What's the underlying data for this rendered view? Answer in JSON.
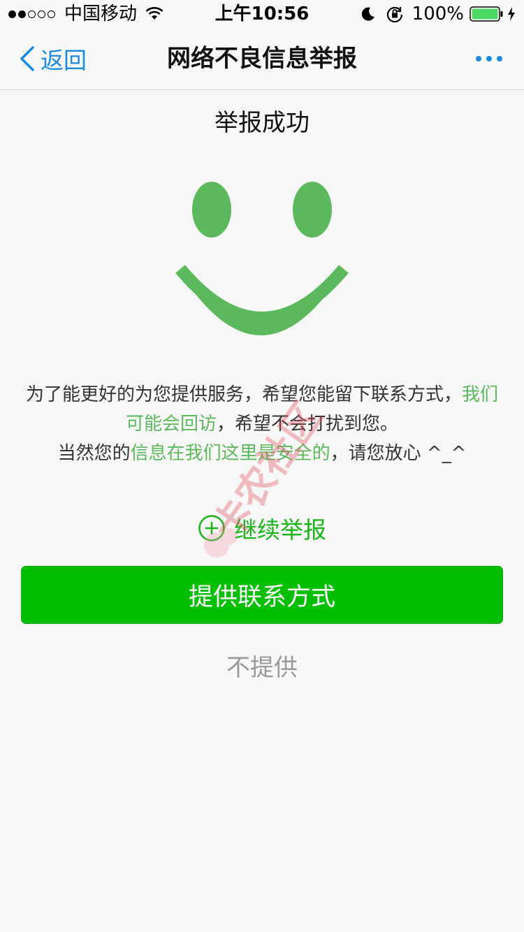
{
  "status_bar": {
    "carrier": "中国移动",
    "time": "上午10:56",
    "battery": "100%"
  },
  "nav": {
    "back_label": "返回",
    "title": "网络不良信息举报"
  },
  "content": {
    "success_title": "举报成功",
    "message": {
      "line1_prefix": "为了能更好的为您提供服务，希望您能留下联系方式，",
      "line1_green": "我们",
      "line2_green": "可能会回访",
      "line2_suffix": "，希望不会打扰到您。",
      "line3_prefix": "当然您的",
      "line3_green": "信息在我们这里是安全的",
      "line3_suffix": "，请您放心 ^_^"
    },
    "continue_label": "继续举报",
    "provide_button": "提供联系方式",
    "decline_label": "不提供"
  },
  "watermark_text": "卡农社区",
  "colors": {
    "accent_green": "#5cb85c",
    "button_green": "#04be02",
    "link_blue": "#1a8be0"
  },
  "icons": [
    "wifi-icon",
    "moon-icon",
    "rotation-lock-icon",
    "battery-icon",
    "charging-icon",
    "back-chevron-icon",
    "more-icon",
    "smiley-icon",
    "plus-circle-icon"
  ]
}
